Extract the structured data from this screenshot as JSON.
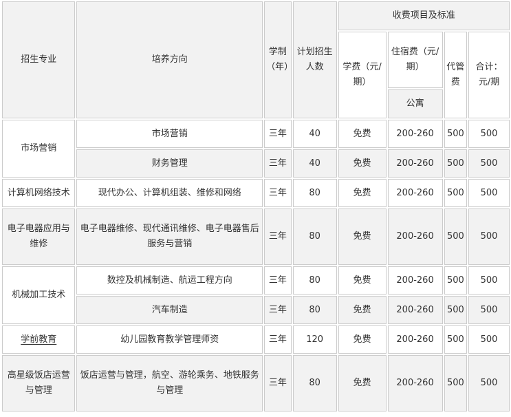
{
  "header": {
    "major": "招生专业",
    "direction": "培养方向",
    "duration": "学制（年）",
    "quota": "计划招生人数",
    "fees_group": "收费项目及标准",
    "tuition": "学费（元/期）",
    "lodging": "住宿费（元/期）",
    "apartment": "公寓",
    "agency": "代管费",
    "total": "合计：元/期"
  },
  "rows": [
    {
      "major": "市场营销",
      "direction": "市场营销",
      "duration": "三年",
      "quota": "40",
      "tuition": "免费",
      "lodging": "200-260",
      "agency": "500",
      "total": "500"
    },
    {
      "direction": "财务管理",
      "duration": "三年",
      "quota": "40",
      "tuition": "免费",
      "lodging": "200-260",
      "agency": "500",
      "total": "500"
    },
    {
      "major": "计算机网络技术",
      "direction": "现代办公、计算机组装、维修和网络",
      "duration": "三年",
      "quota": "80",
      "tuition": "免费",
      "lodging": "200-260",
      "agency": "500",
      "total": "500"
    },
    {
      "major": "电子电器应用与维修",
      "direction": "电子电器维修、现代通讯维修、电子电器售后服务与营销",
      "duration": "三年",
      "quota": "80",
      "tuition": "免费",
      "lodging": "200-260",
      "agency": "500",
      "total": "500"
    },
    {
      "major": "机械加工技术",
      "direction": "数控及机械制造、航运工程方向",
      "duration": "三年",
      "quota": "80",
      "tuition": "免费",
      "lodging": "200-260",
      "agency": "500",
      "total": "500"
    },
    {
      "direction": "汽车制造",
      "duration": "三年",
      "quota": "80",
      "tuition": "免费",
      "lodging": "200-260",
      "agency": "500",
      "total": "500"
    },
    {
      "major": "学前教育",
      "direction": "幼儿园教育教学管理师资",
      "duration": "三年",
      "quota": "120",
      "tuition": "免费",
      "lodging": "200-260",
      "agency": "500",
      "total": "500"
    },
    {
      "major": "高星级饭店运营与管理",
      "direction": "饭店运营与管理，航空、游轮乘务、地铁服务与管理",
      "duration": "三年",
      "quota": "80",
      "tuition": "免费",
      "lodging": "200-260",
      "agency": "500",
      "total": "500"
    }
  ]
}
